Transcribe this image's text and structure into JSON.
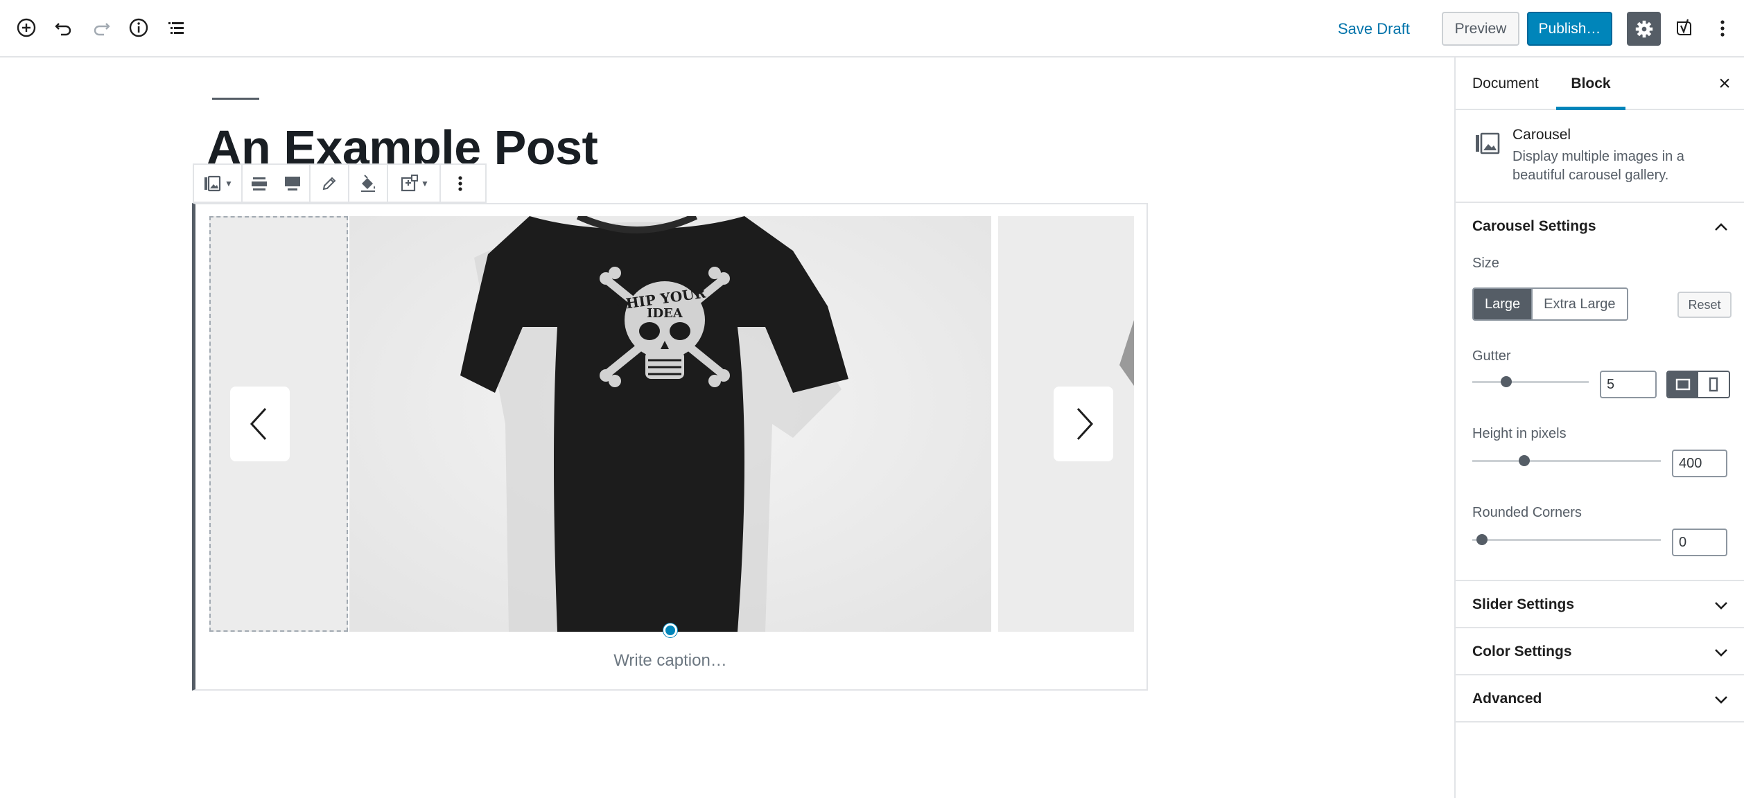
{
  "topbar": {
    "save_draft": "Save Draft",
    "preview": "Preview",
    "publish": "Publish…",
    "icons": [
      "add-block-icon",
      "undo-icon",
      "redo-icon",
      "info-icon",
      "outline-icon",
      "gear-icon",
      "yoast-icon",
      "more-icon"
    ]
  },
  "editor": {
    "post_title": "An Example Post",
    "caption_placeholder": "Write caption…",
    "block_toolbar_icons": [
      "carousel-block-icon",
      "align-wide-icon",
      "align-full-icon",
      "edit-icon",
      "fill-icon",
      "image-sizes-icon",
      "more-options-icon"
    ]
  },
  "sidebar": {
    "tabs": {
      "document": "Document",
      "block": "Block",
      "active": "Block"
    },
    "block_card": {
      "title": "Carousel",
      "description": "Display multiple images in a beautiful carousel gallery."
    },
    "carousel_settings": {
      "title": "Carousel Settings",
      "size_label": "Size",
      "size_options": [
        "Large",
        "Extra Large"
      ],
      "size_selected": "Large",
      "reset_label": "Reset",
      "gutter_label": "Gutter",
      "gutter_value": "5",
      "height_label": "Height in pixels",
      "height_value": "400",
      "radius_label": "Rounded Corners",
      "radius_value": "0"
    },
    "panels": {
      "slider": "Slider Settings",
      "color": "Color Settings",
      "advanced": "Advanced"
    }
  },
  "colors": {
    "primary": "#0085ba",
    "dark": "#555d66",
    "border": "#e2e4e7"
  }
}
